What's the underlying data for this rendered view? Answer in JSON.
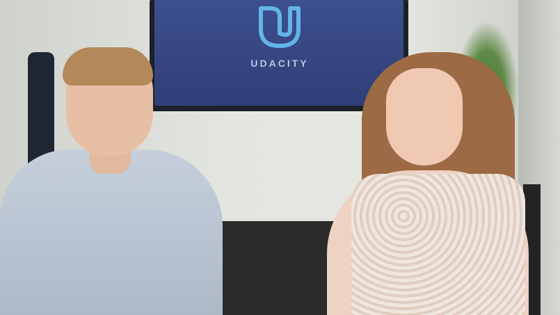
{
  "tv": {
    "brand": "UDACITY"
  }
}
